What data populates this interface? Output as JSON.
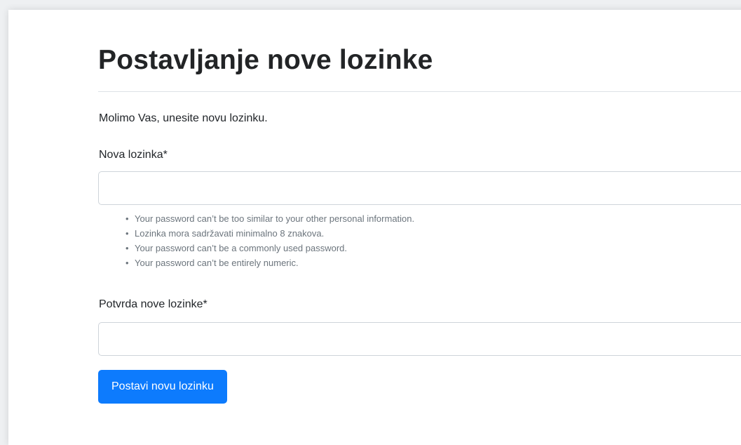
{
  "page": {
    "title": "Postavljanje nove lozinke",
    "intro": "Molimo Vas, unesite novu lozinku."
  },
  "form": {
    "new_password": {
      "label": "Nova lozinka*",
      "value": ""
    },
    "help_texts": [
      "Your password can’t be too similar to your other personal information.",
      "Lozinka mora sadržavati minimalno 8 znakova.",
      "Your password can’t be a commonly used password.",
      "Your password can’t be entirely numeric."
    ],
    "confirm_password": {
      "label": "Potvrda nove lozinke*",
      "value": ""
    },
    "submit_label": "Postavi novu lozinku"
  },
  "colors": {
    "primary_button": "#0d7bfd",
    "help_text": "#6c757d",
    "input_border": "#ced4da"
  },
  "icons": {
    "bullet": "•"
  }
}
